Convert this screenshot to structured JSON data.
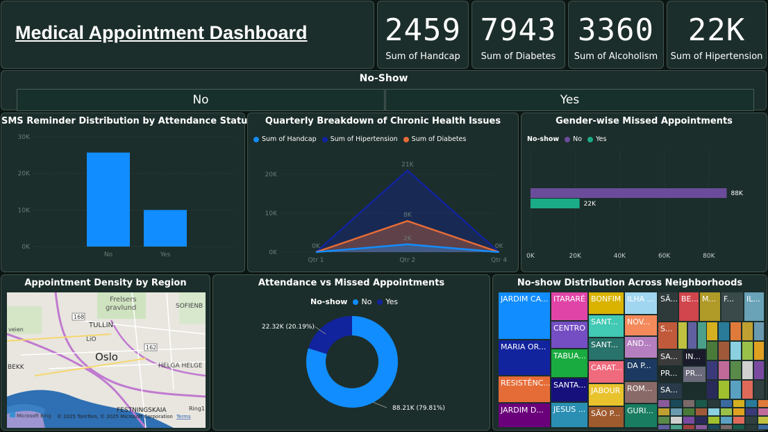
{
  "title": "Medical Appointment Dashboard",
  "kpis": [
    {
      "value": "2459",
      "label": "Sum of Handcap"
    },
    {
      "value": "7943",
      "label": "Sum of Diabetes"
    },
    {
      "value": "3360",
      "label": "Sum of Alcoholism"
    },
    {
      "value": "22K",
      "label": "Sum of Hipertension"
    }
  ],
  "slicer": {
    "title": "No-Show",
    "options": [
      "No",
      "Yes"
    ]
  },
  "charts": {
    "sms": {
      "title": "SMS Reminder Distribution by Attendance Status"
    },
    "quarterly": {
      "title": "Quarterly Breakdown of Chronic Health Issues"
    },
    "gender": {
      "title": "Gender-wise Missed Appointments",
      "legend_title": "No-show"
    },
    "map": {
      "title": "Appointment Density by Region",
      "labels": {
        "frelsers": "Frelsers",
        "gravlund": "gravlund",
        "oslo": "Oslo",
        "tullin": "TULLIN",
        "sofienb": "SOFIENB",
        "helga": "HELGA HELGE",
        "festning": "FESTNINGSKAIA",
        "road168": "168",
        "road162": "162",
        "bekk": "BEKK",
        "lio": "LiO",
        "ring1": "Ring1",
        "bing": "Microsoft Bing",
        "copyright": "© 2025 TomTom, © 2025 Microsoft Corporation",
        "terms": "Terms",
        "veien": "veien"
      }
    },
    "donut": {
      "title": "Attendance vs Missed Appointments",
      "legend_title": "No-show"
    },
    "treemap": {
      "title": "No-show Distribution Across Neighborhoods"
    }
  },
  "chart_data": [
    {
      "type": "bar",
      "title": "SMS Reminder Distribution by Attendance Status",
      "categories": [
        "No",
        "Yes"
      ],
      "values": [
        25700,
        10000
      ],
      "yticks": [
        "0K",
        "10K",
        "20K",
        "30K"
      ],
      "ylim": [
        0,
        30000
      ],
      "color": "#118dff"
    },
    {
      "type": "area",
      "title": "Quarterly Breakdown of Chronic Health Issues",
      "categories": [
        "Qtr 1",
        "Qtr 2",
        "Qtr 4"
      ],
      "series": [
        {
          "name": "Sum of Handcap",
          "values": [
            0,
            2000,
            0
          ],
          "color": "#118dff"
        },
        {
          "name": "Sum of Hipertension",
          "values": [
            0,
            21000,
            0
          ],
          "color": "#12239e"
        },
        {
          "name": "Sum of Diabetes",
          "values": [
            0,
            8000,
            0
          ],
          "color": "#e66c37"
        }
      ],
      "data_labels": [
        "0K",
        "21K",
        "8K",
        "2K",
        "0K"
      ],
      "yticks": [
        "0K",
        "10K",
        "20K"
      ],
      "ylim": [
        0,
        25000
      ]
    },
    {
      "type": "bar",
      "orientation": "horizontal",
      "title": "Gender-wise Missed Appointments",
      "series": [
        {
          "name": "No",
          "value": 88000,
          "label": "88K",
          "color": "#6b4c9a"
        },
        {
          "name": "Yes",
          "value": 22000,
          "label": "22K",
          "color": "#1aab87"
        }
      ],
      "xticks": [
        "0K",
        "20K",
        "40K",
        "60K",
        "80K"
      ],
      "xlim": [
        0,
        95000
      ]
    },
    {
      "type": "pie",
      "title": "Attendance vs Missed Appointments",
      "series": [
        {
          "name": "No",
          "value": 88.21,
          "label": "88.21K (79.81%)",
          "color": "#118dff"
        },
        {
          "name": "Yes",
          "value": 22.32,
          "label": "22.32K (20.19%)",
          "color": "#12239e"
        }
      ]
    },
    {
      "type": "heatmap",
      "title": "No-show Distribution Across Neighborhoods",
      "cells": [
        {
          "label": "JARDIM CA...",
          "color": "#118dff"
        },
        {
          "label": "MARIA OR...",
          "color": "#12239e"
        },
        {
          "label": "RESISTÊNC...",
          "color": "#e66c37"
        },
        {
          "label": "JARDIM D...",
          "color": "#6b007b"
        },
        {
          "label": "ITARARÉ",
          "color": "#e044a7"
        },
        {
          "label": "CENTRO",
          "color": "#744ec2"
        },
        {
          "label": "TABUA...",
          "color": "#1aab40"
        },
        {
          "label": "SANTA...",
          "color": "#15107b"
        },
        {
          "label": "JESUS ...",
          "color": "#2b8fb3"
        },
        {
          "label": "BONFIM",
          "color": "#d9b300"
        },
        {
          "label": "SANT...",
          "color": "#41c9b4"
        },
        {
          "label": "SANT...",
          "color": "#28736b"
        },
        {
          "label": "CARAT...",
          "color": "#f06a7d"
        },
        {
          "label": "JABOUR",
          "color": "#e8c32e"
        },
        {
          "label": "SÃO P...",
          "color": "#9f5a2e"
        },
        {
          "label": "ILHA ...",
          "color": "#a1d6f0"
        },
        {
          "label": "NOV...",
          "color": "#f48a5c"
        },
        {
          "label": "AND...",
          "color": "#b57fbf"
        },
        {
          "label": "DA P...",
          "color": "#1c3a61"
        },
        {
          "label": "ROM...",
          "color": "#8a6a69"
        },
        {
          "label": "GURI...",
          "color": "#187d61"
        },
        {
          "label": "SÃ...",
          "color": "#2e3a3a"
        },
        {
          "label": "BE...",
          "color": "#d1454c"
        },
        {
          "label": "M...",
          "color": "#b09a28"
        },
        {
          "label": "F...",
          "color": "#3a4a4a"
        },
        {
          "label": "IL...",
          "color": "#6aa3b8"
        },
        {
          "label": "S...",
          "color": "#c05a3a"
        },
        {
          "label": "SA...",
          "color": "#3a3a3a"
        },
        {
          "label": "IN...",
          "color": "#1a1a2a"
        },
        {
          "label": "PR...",
          "color": "#1f2a2a"
        },
        {
          "label": "PR...",
          "color": "#6a6a7a"
        },
        {
          "label": "SA...",
          "color": "#2a3a4a"
        }
      ]
    }
  ]
}
